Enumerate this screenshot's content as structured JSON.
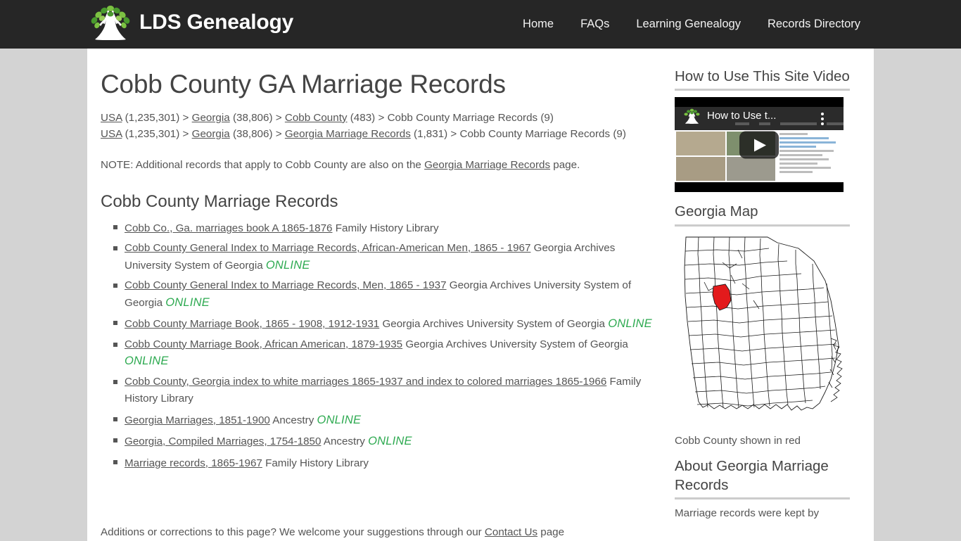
{
  "site": {
    "brand_name": "LDS Genealogy",
    "brand_logo_icon": "tree-logo-icon",
    "nav": [
      {
        "label": "Home",
        "name": "nav-home"
      },
      {
        "label": "FAQs",
        "name": "nav-faqs"
      },
      {
        "label": "Learning Genealogy",
        "name": "nav-learning-genealogy"
      },
      {
        "label": "Records Directory",
        "name": "nav-records-directory"
      }
    ]
  },
  "main": {
    "title": "Cobb County GA Marriage Records",
    "breadcrumb1": {
      "l1_link": "USA",
      "l1_count": "(1,235,301)",
      "sep": ">",
      "l2_link": "Georgia",
      "l2_count": "(38,806)",
      "l3_link": "Cobb County",
      "l3_count": "(483)",
      "l4_text": "Cobb County Marriage Records",
      "l4_count": "(9)"
    },
    "breadcrumb2": {
      "l1_link": "USA",
      "l1_count": "(1,235,301)",
      "l2_link": "Georgia",
      "l2_count": "(38,806)",
      "l3_link": "Georgia Marriage Records",
      "l3_count": "(1,831)",
      "l4_text": "Cobb County Marriage Records",
      "l4_count": "(9)"
    },
    "note_prefix": "NOTE: Additional records that apply to Cobb County are also on the ",
    "note_link": "Georgia Marriage Records",
    "note_suffix": " page.",
    "section_title": "Cobb County Marriage Records",
    "records": [
      {
        "link": "Cobb Co., Ga. marriages book A 1865-1876",
        "source": " Family History Library",
        "online": ""
      },
      {
        "link": "Cobb County General Index to Marriage Records, African-American Men, 1865 - 1967",
        "source": " Georgia Archives University System of Georgia ",
        "online": "ONLINE"
      },
      {
        "link": "Cobb County General Index to Marriage Records, Men, 1865 - 1937",
        "source": " Georgia Archives University System of Georgia ",
        "online": "ONLINE"
      },
      {
        "link": "Cobb County Marriage Book, 1865 - 1908, 1912-1931",
        "source": " Georgia Archives University System of Georgia ",
        "online": "ONLINE"
      },
      {
        "link": "Cobb County Marriage Book, African American, 1879-1935",
        "source": " Georgia Archives University System of Georgia ",
        "online": "ONLINE"
      },
      {
        "link": "Cobb County, Georgia index to white marriages 1865-1937 and index to colored marriages 1865-1966",
        "source": " Family History Library",
        "online": ""
      },
      {
        "link": "Georgia Marriages, 1851-1900",
        "source": " Ancestry ",
        "online": "ONLINE"
      },
      {
        "link": "Georgia, Compiled Marriages, 1754-1850",
        "source": " Ancestry ",
        "online": "ONLINE"
      },
      {
        "link": "Marriage records, 1865-1967",
        "source": " Family History Library",
        "online": ""
      }
    ],
    "feedback_prefix": "Additions or corrections to this page? We welcome your suggestions through our ",
    "feedback_link": "Contact Us",
    "feedback_suffix": " page"
  },
  "sidebar": {
    "video_heading": "How to Use This Site Video",
    "video_title": "How to Use t...",
    "video_play_icon": "play-button-icon",
    "map_heading": "Georgia Map",
    "map_caption": "Cobb County shown in red",
    "about_heading": "About Georgia Marriage Records",
    "about_text": "Marriage records were kept by"
  },
  "colors": {
    "header_bg": "#262626",
    "page_bg": "#d3d3d3",
    "content_bg": "#ffffff",
    "text": "#555555",
    "heading": "#444444",
    "online_green": "#2eaa51",
    "county_red": "#e31a1c",
    "rule": "#cccccc"
  }
}
